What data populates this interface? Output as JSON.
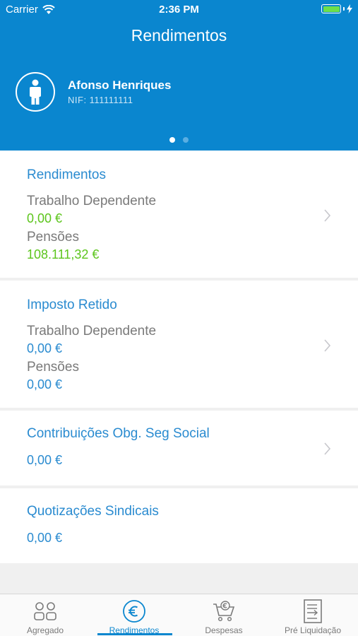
{
  "status_bar": {
    "carrier": "Carrier",
    "time": "2:36 PM",
    "battery_color": "#6de04a"
  },
  "header": {
    "title": "Rendimentos",
    "user": {
      "name": "Afonso Henriques",
      "nif": "NIF: 111111111"
    },
    "pager": {
      "count": 2,
      "active": 1
    }
  },
  "cards": {
    "rendimentos": {
      "title": "Rendimentos",
      "rows": [
        {
          "label": "Trabalho Dependente",
          "value": "0,00 €"
        },
        {
          "label": "Pensões",
          "value": "108.111,32 €"
        }
      ]
    },
    "imposto": {
      "title": "Imposto Retido",
      "rows": [
        {
          "label": "Trabalho Dependente",
          "value": "0,00 €"
        },
        {
          "label": "Pensões",
          "value": "0,00 €"
        }
      ]
    },
    "contribuicoes": {
      "title": "Contribuições Obg. Seg Social",
      "value": "0,00 €"
    },
    "quotizacoes": {
      "title": "Quotizações Sindicais",
      "value": "0,00 €"
    }
  },
  "tabbar": {
    "active": "Rendimentos",
    "tabs": [
      {
        "label": "Agregado",
        "icon": "people-icon"
      },
      {
        "label": "Rendimentos",
        "icon": "euro-icon"
      },
      {
        "label": "Despesas",
        "icon": "cart-icon"
      },
      {
        "label": "Pré Liquidação",
        "icon": "document-icon"
      }
    ]
  },
  "colors": {
    "primary": "#0a86cf",
    "positive": "#5cc51c",
    "muted": "#7a7a7a"
  }
}
